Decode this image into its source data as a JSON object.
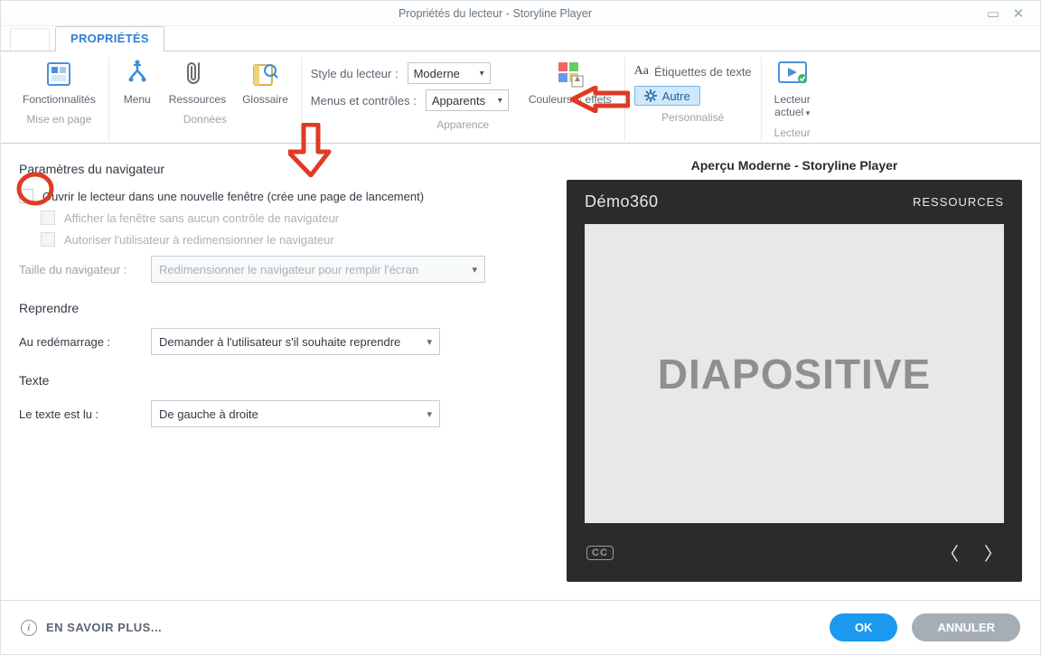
{
  "window": {
    "title": "Propriétés du lecteur - Storyline Player"
  },
  "tabs": {
    "properties": "PROPRIÉTÉS"
  },
  "ribbon": {
    "functionalities": "Fonctionnalités",
    "layout": "Mise en page",
    "menu": "Menu",
    "resources": "Ressources",
    "glossary": "Glossaire",
    "data_group": "Données",
    "style_label": "Style du lecteur :",
    "style_value": "Moderne",
    "controls_label": "Menus et contrôles :",
    "controls_value": "Apparents",
    "appearance_group": "Apparence",
    "colors_effects": "Couleurs & effets",
    "text_labels_aa": "Étiquettes de texte",
    "other": "Autre",
    "customized_group": "Personnalisé",
    "current_player_top": "Lecteur",
    "current_player_bottom": "actuel",
    "player_group": "Lecteur"
  },
  "settings": {
    "nav_section": "Paramètres du navigateur",
    "open_new_window": "Ouvrir le lecteur dans une nouvelle fenêtre (crée une page de lancement)",
    "no_controls": "Afficher la fenêtre sans aucun contrôle de navigateur",
    "allow_resize": "Autoriser l'utilisateur à redimensionner le navigateur",
    "size_label": "Taille du navigateur :",
    "size_value": "Redimensionner le navigateur pour remplir l'écran",
    "resume_section": "Reprendre",
    "on_restart_label": "Au redémarrage :",
    "on_restart_value": "Demander à l'utilisateur s'il souhaite reprendre",
    "text_section": "Texte",
    "text_dir_label": "Le texte est lu :",
    "text_dir_value": "De gauche à droite"
  },
  "preview": {
    "title": "Aperçu Moderne - Storyline Player",
    "project": "Démo360",
    "resources": "RESSOURCES",
    "slide_word": "DIAPOSITIVE",
    "cc": "CC"
  },
  "footer": {
    "learn_more": "EN SAVOIR PLUS...",
    "ok": "OK",
    "cancel": "ANNULER"
  }
}
